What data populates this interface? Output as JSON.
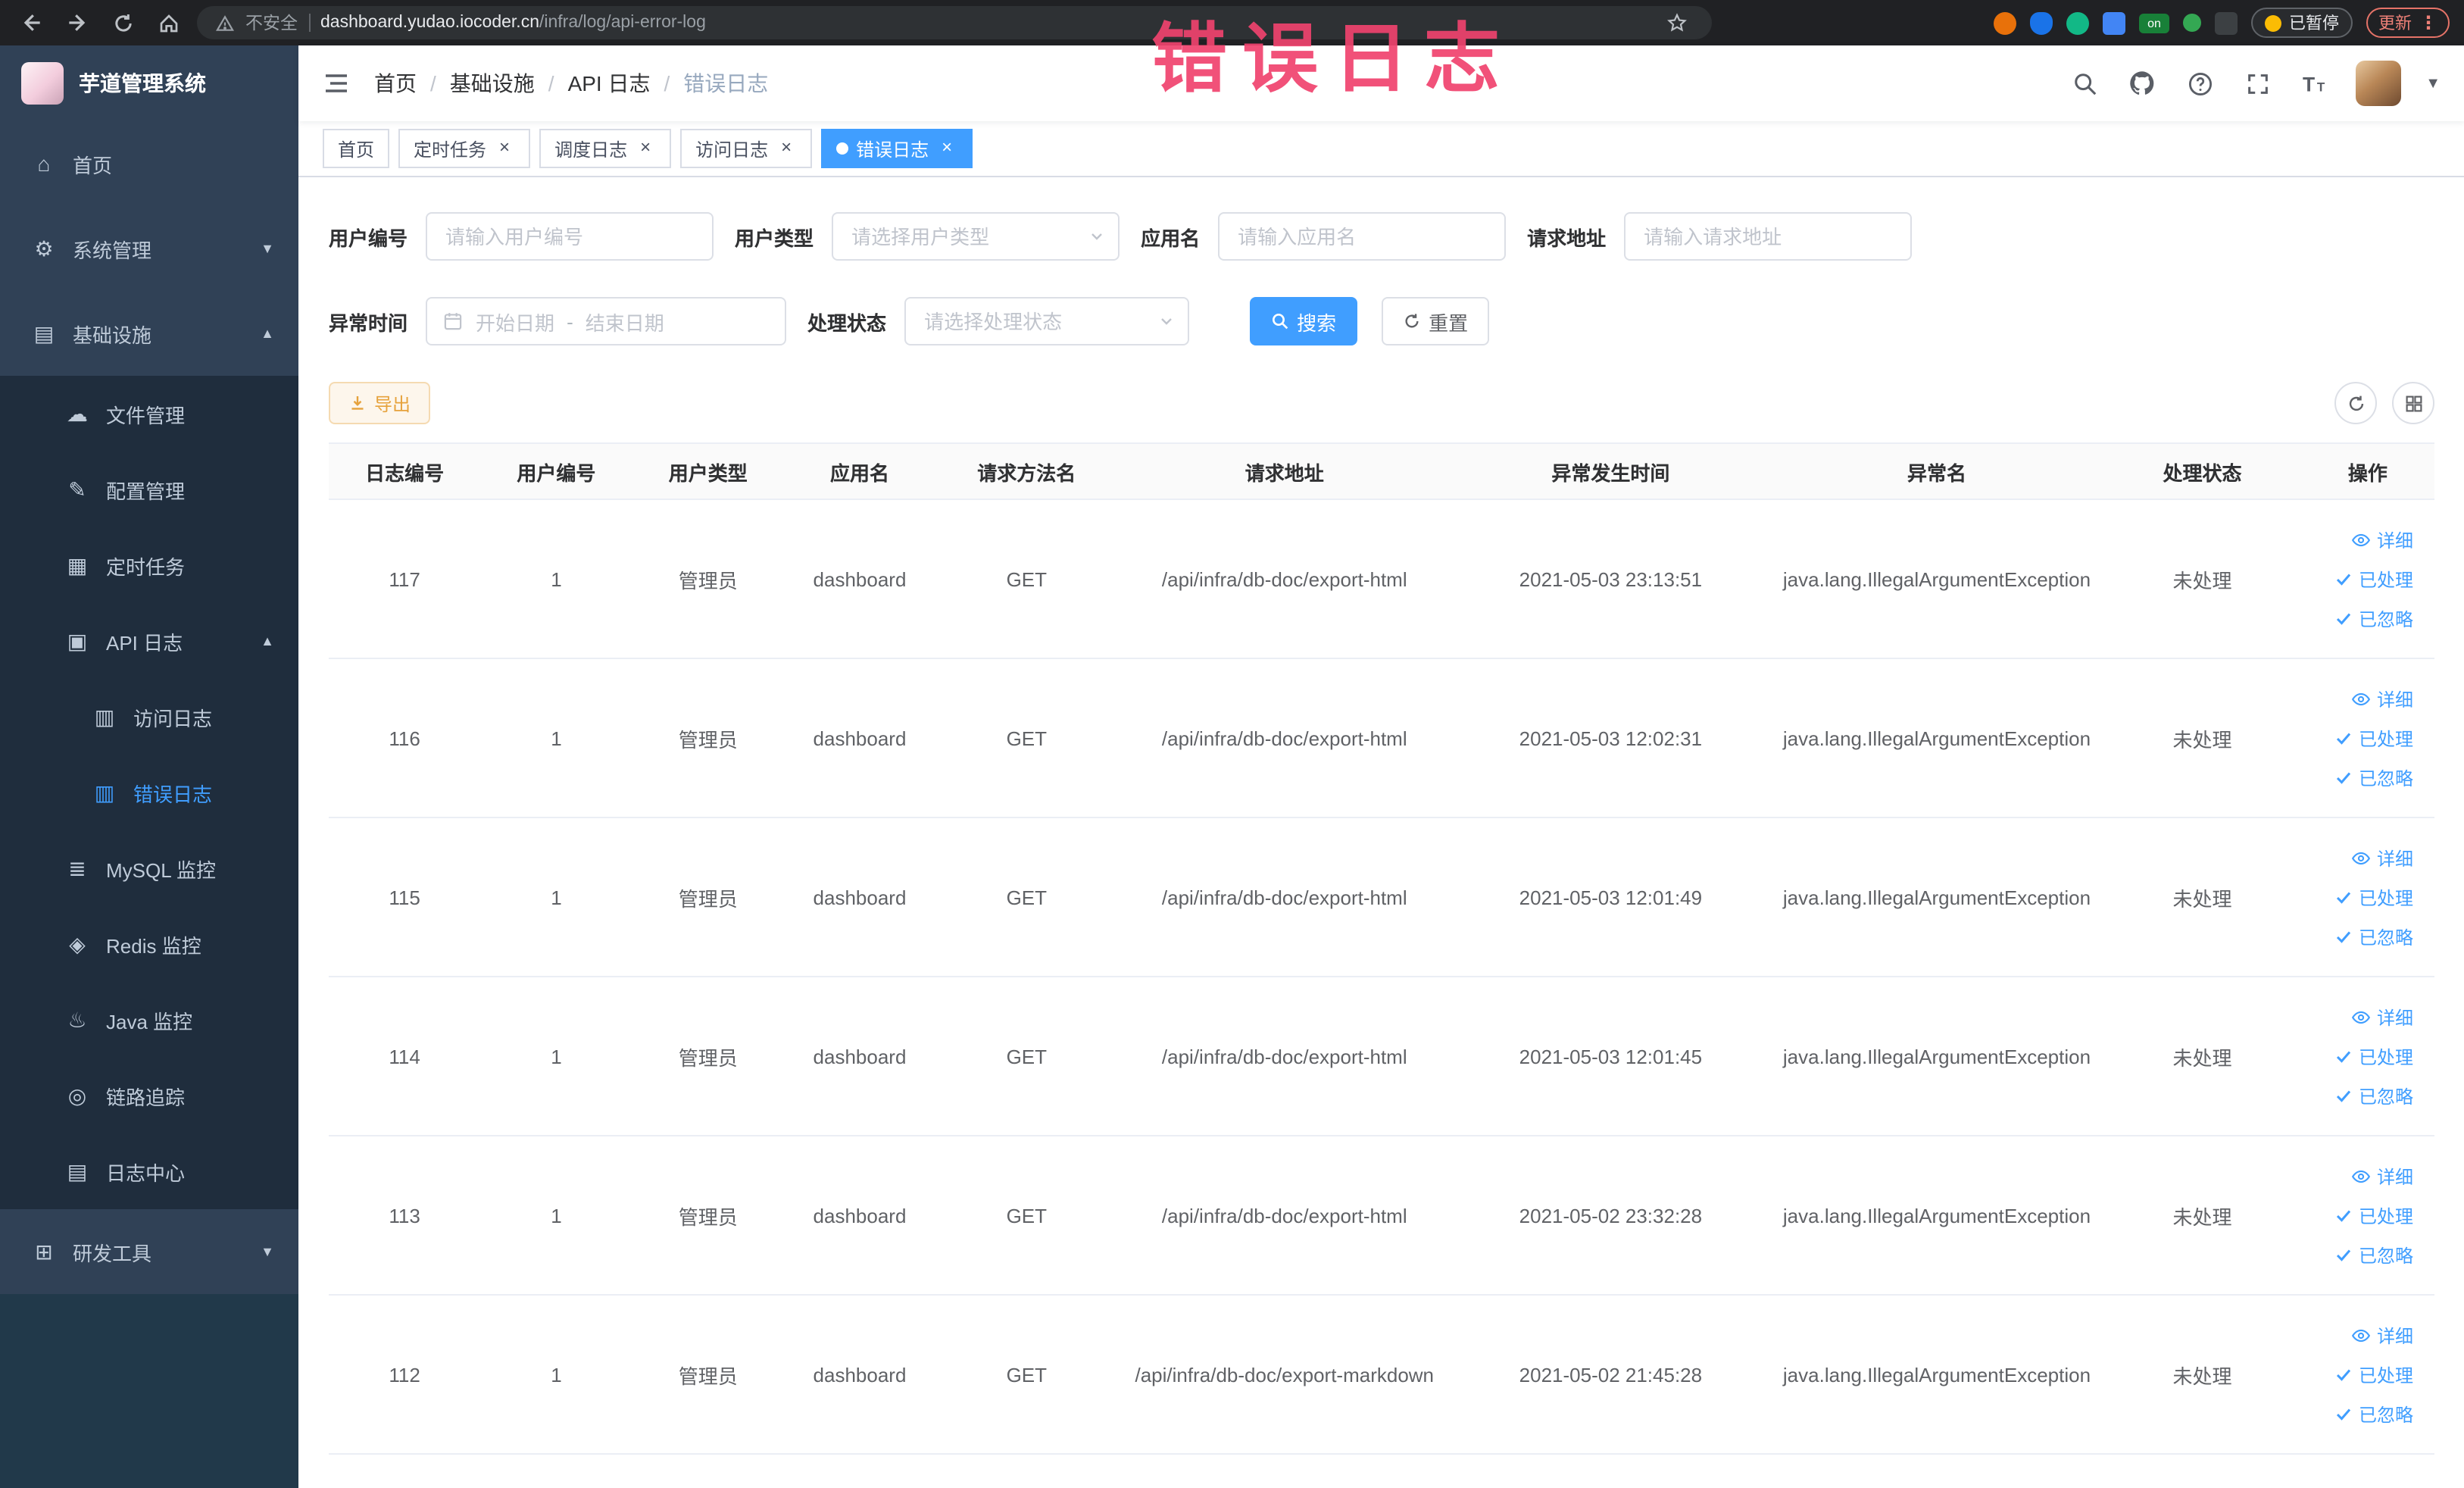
{
  "colors": {
    "primary": "#409eff",
    "annotation": "#f0436e",
    "warning": "#e6a23c",
    "sidebar_bg": "#304156",
    "submenu_bg": "#1f2d3d"
  },
  "browser": {
    "security_label": "不安全",
    "url_domain": "dashboard.yudao.iocoder.cn",
    "url_path": "/infra/log/api-error-log",
    "extension_badge": "on",
    "paused_chip": "已暂停",
    "update_chip": "更新"
  },
  "annotation": {
    "text": "错误日志"
  },
  "sidebar": {
    "logo_title": "芋道管理系统",
    "items": [
      {
        "name": "home",
        "label": "首页",
        "icon": "home-icon",
        "level": 1
      },
      {
        "name": "system-management",
        "label": "系统管理",
        "icon": "gear-icon",
        "level": 1,
        "arrow": "down"
      },
      {
        "name": "infrastructure",
        "label": "基础设施",
        "icon": "infra-icon",
        "level": 1,
        "arrow": "up"
      },
      {
        "name": "file-management",
        "label": "文件管理",
        "icon": "file-icon",
        "level": 2,
        "sub": true
      },
      {
        "name": "config-management",
        "label": "配置管理",
        "icon": "config-icon",
        "level": 2,
        "sub": true
      },
      {
        "name": "scheduled-jobs",
        "label": "定时任务",
        "icon": "job-icon",
        "level": 2,
        "sub": true
      },
      {
        "name": "api-log",
        "label": "API 日志",
        "icon": "api-log-icon",
        "level": 2,
        "sub": true,
        "arrow": "up"
      },
      {
        "name": "access-log",
        "label": "访问日志",
        "icon": "doc-icon",
        "level": 3,
        "sub": true
      },
      {
        "name": "error-log",
        "label": "错误日志",
        "icon": "doc-icon",
        "level": 3,
        "sub": true,
        "active": true
      },
      {
        "name": "mysql-monitor",
        "label": "MySQL 监控",
        "icon": "mysql-icon",
        "level": 2,
        "sub": true
      },
      {
        "name": "redis-monitor",
        "label": "Redis 监控",
        "icon": "redis-icon",
        "level": 2,
        "sub": true
      },
      {
        "name": "java-monitor",
        "label": "Java 监控",
        "icon": "java-icon",
        "level": 2,
        "sub": true
      },
      {
        "name": "trace",
        "label": "链路追踪",
        "icon": "trace-icon",
        "level": 2,
        "sub": true
      },
      {
        "name": "log-center",
        "label": "日志中心",
        "icon": "log-center-icon",
        "level": 2,
        "sub": true
      },
      {
        "name": "dev-tools",
        "label": "研发工具",
        "icon": "tool-icon",
        "level": 1,
        "arrow": "down"
      }
    ]
  },
  "header": {
    "breadcrumb": [
      "首页",
      "基础设施",
      "API 日志",
      "错误日志"
    ]
  },
  "tabs": [
    {
      "name": "home",
      "label": "首页",
      "closable": false,
      "active": false
    },
    {
      "name": "scheduled-jobs",
      "label": "定时任务",
      "closable": true,
      "active": false
    },
    {
      "name": "schedule-log",
      "label": "调度日志",
      "closable": true,
      "active": false
    },
    {
      "name": "access-log",
      "label": "访问日志",
      "closable": true,
      "active": false
    },
    {
      "name": "error-log",
      "label": "错误日志",
      "closable": true,
      "active": true
    }
  ],
  "filters": {
    "user_id": {
      "label": "用户编号",
      "placeholder": "请输入用户编号"
    },
    "user_type": {
      "label": "用户类型",
      "placeholder": "请选择用户类型"
    },
    "app_name": {
      "label": "应用名",
      "placeholder": "请输入应用名"
    },
    "request_url": {
      "label": "请求地址",
      "placeholder": "请输入请求地址"
    },
    "exception_time": {
      "label": "异常时间",
      "start_placeholder": "开始日期",
      "separator": "-",
      "end_placeholder": "结束日期"
    },
    "process_status": {
      "label": "处理状态",
      "placeholder": "请选择处理状态"
    },
    "search_label": "搜索",
    "reset_label": "重置"
  },
  "toolbar": {
    "export_label": "导出"
  },
  "table": {
    "columns": [
      "日志编号",
      "用户编号",
      "用户类型",
      "应用名",
      "请求方法名",
      "请求地址",
      "异常发生时间",
      "异常名",
      "处理状态",
      "操作"
    ],
    "row_actions": [
      "详细",
      "已处理",
      "已忽略"
    ],
    "rows": [
      {
        "id": "117",
        "user_id": "1",
        "user_type": "管理员",
        "app": "dashboard",
        "method": "GET",
        "url": "/api/infra/db-doc/export-html",
        "time": "2021-05-03 23:13:51",
        "exception": "java.lang.IllegalArgumentException",
        "status": "未处理"
      },
      {
        "id": "116",
        "user_id": "1",
        "user_type": "管理员",
        "app": "dashboard",
        "method": "GET",
        "url": "/api/infra/db-doc/export-html",
        "time": "2021-05-03 12:02:31",
        "exception": "java.lang.IllegalArgumentException",
        "status": "未处理"
      },
      {
        "id": "115",
        "user_id": "1",
        "user_type": "管理员",
        "app": "dashboard",
        "method": "GET",
        "url": "/api/infra/db-doc/export-html",
        "time": "2021-05-03 12:01:49",
        "exception": "java.lang.IllegalArgumentException",
        "status": "未处理"
      },
      {
        "id": "114",
        "user_id": "1",
        "user_type": "管理员",
        "app": "dashboard",
        "method": "GET",
        "url": "/api/infra/db-doc/export-html",
        "time": "2021-05-03 12:01:45",
        "exception": "java.lang.IllegalArgumentException",
        "status": "未处理"
      },
      {
        "id": "113",
        "user_id": "1",
        "user_type": "管理员",
        "app": "dashboard",
        "method": "GET",
        "url": "/api/infra/db-doc/export-html",
        "time": "2021-05-02 23:32:28",
        "exception": "java.lang.IllegalArgumentException",
        "status": "未处理"
      },
      {
        "id": "112",
        "user_id": "1",
        "user_type": "管理员",
        "app": "dashboard",
        "method": "GET",
        "url": "/api/infra/db-doc/export-markdown",
        "time": "2021-05-02 21:45:28",
        "exception": "java.lang.IllegalArgumentException",
        "status": "未处理"
      }
    ]
  }
}
